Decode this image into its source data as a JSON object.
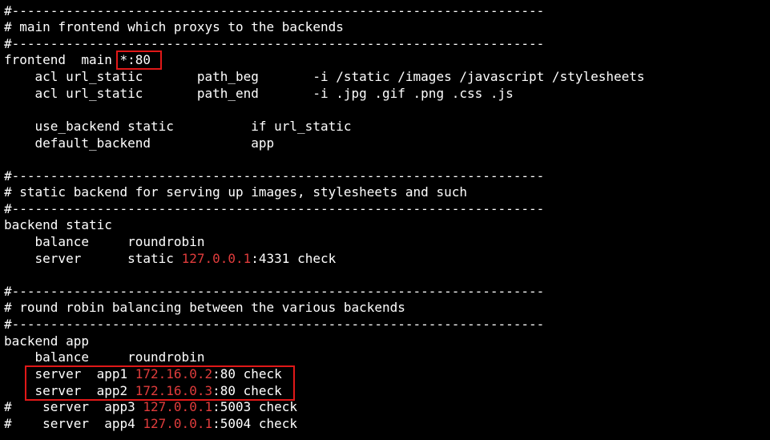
{
  "terminal": {
    "lines": [
      {
        "t": "#---------------------------------------------------------------------"
      },
      {
        "t": "# main frontend which proxys to the backends"
      },
      {
        "t": "#---------------------------------------------------------------------"
      },
      {
        "t": "frontend  main *:80"
      },
      {
        "t": "    acl url_static       path_beg       -i /static /images /javascript /stylesheets"
      },
      {
        "t": "    acl url_static       path_end       -i .jpg .gif .png .css .js"
      },
      {
        "t": ""
      },
      {
        "t": "    use_backend static          if url_static"
      },
      {
        "t": "    default_backend             app"
      },
      {
        "t": ""
      },
      {
        "t": "#---------------------------------------------------------------------"
      },
      {
        "t": "# static backend for serving up images, stylesheets and such"
      },
      {
        "t": "#---------------------------------------------------------------------"
      },
      {
        "t": "backend static"
      },
      {
        "t": "    balance     roundrobin"
      },
      {
        "pre": "    server      static ",
        "ip": "127.0.0.1",
        "post": ":4331 check"
      },
      {
        "t": ""
      },
      {
        "t": "#---------------------------------------------------------------------"
      },
      {
        "t": "# round robin balancing between the various backends"
      },
      {
        "t": "#---------------------------------------------------------------------"
      },
      {
        "t": "backend app"
      },
      {
        "t": "    balance     roundrobin"
      },
      {
        "pre": "    server  app1 ",
        "ip": "172.16.0.2",
        "post": ":80 check"
      },
      {
        "pre": "    server  app2 ",
        "ip": "172.16.0.3",
        "post": ":80 check"
      },
      {
        "pre": "#    server  app3 ",
        "ip": "127.0.0.1",
        "post": ":5003 check"
      },
      {
        "pre": "#    server  app4 ",
        "ip": "127.0.0.1",
        "post": ":5004 check"
      }
    ]
  },
  "colors": {
    "background": "#000000",
    "text": "#ffffff",
    "ip": "#e03c3c",
    "highlight": "#e01818"
  }
}
